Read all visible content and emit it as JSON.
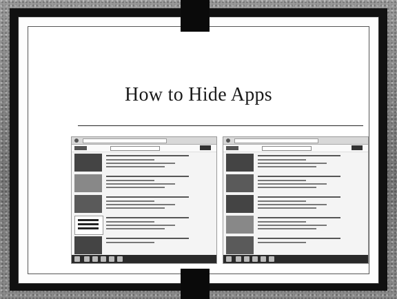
{
  "slide": {
    "title": "How to Hide Apps"
  },
  "screenshots": [
    {
      "id": "left",
      "results": 5
    },
    {
      "id": "right",
      "results": 5
    }
  ]
}
